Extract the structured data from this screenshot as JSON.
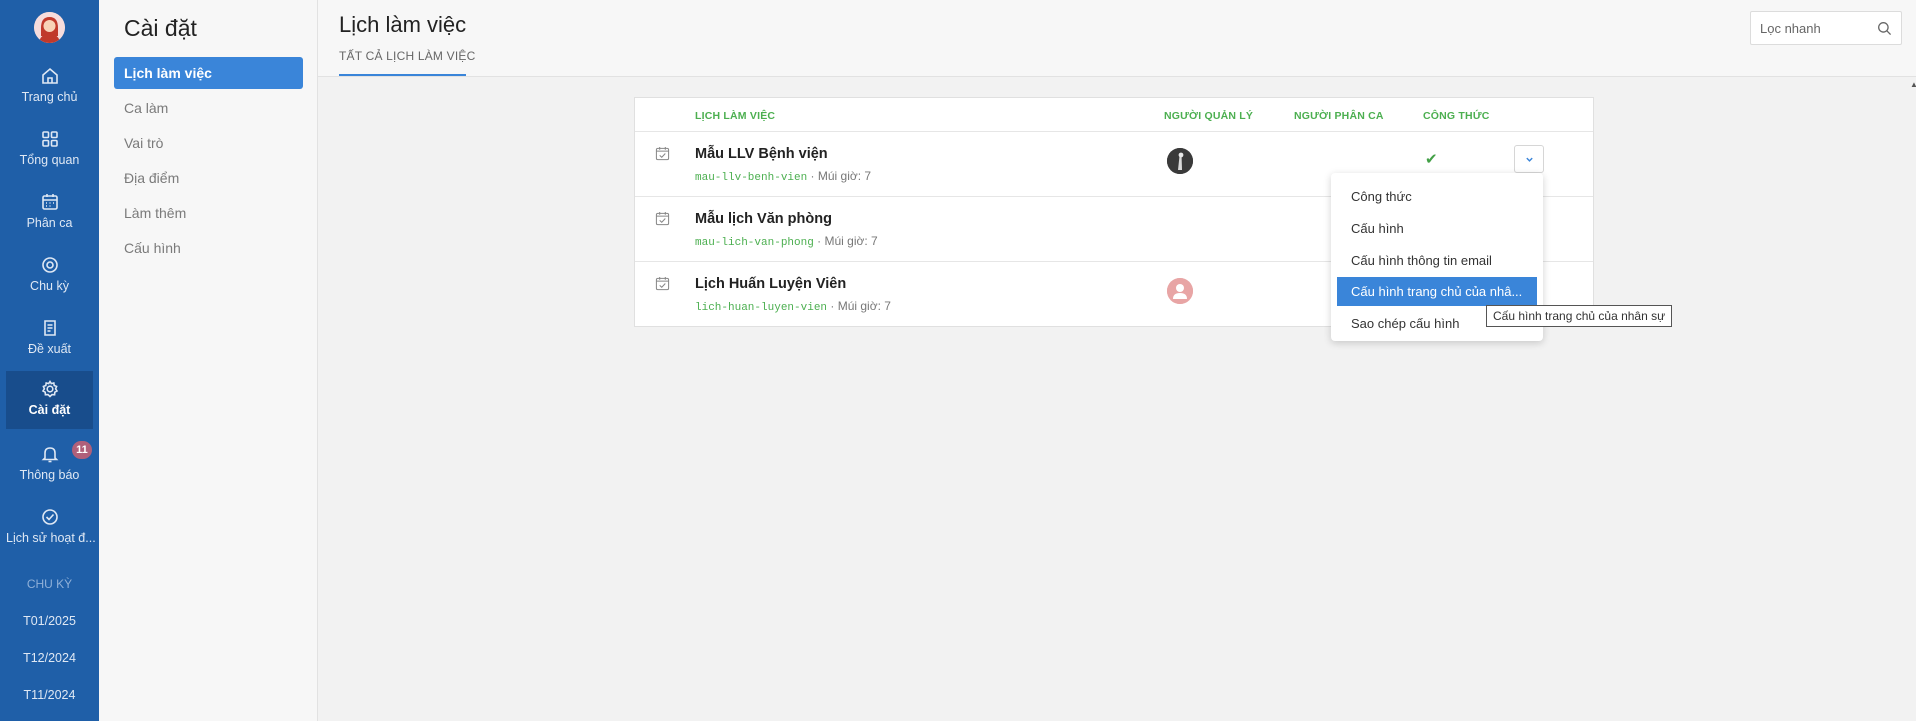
{
  "rail": {
    "items": [
      {
        "label": "Trang chủ",
        "icon": "home-icon"
      },
      {
        "label": "Tổng quan",
        "icon": "grid-icon"
      },
      {
        "label": "Phân ca",
        "icon": "calendar-icon"
      },
      {
        "label": "Chu kỳ",
        "icon": "circle-icon"
      },
      {
        "label": "Đề xuất",
        "icon": "document-icon"
      },
      {
        "label": "Cài đặt",
        "icon": "gear-icon"
      },
      {
        "label": "Thông báo",
        "icon": "bell-icon"
      },
      {
        "label": "Lịch sử hoạt đ...",
        "icon": "check-circle-icon"
      }
    ],
    "notification_count": "11",
    "cycle_heading": "CHU KỲ",
    "cycles": [
      "T01/2025",
      "T12/2024",
      "T11/2024"
    ],
    "active_color": "#184d8c",
    "background": "#1f5fa8"
  },
  "settings": {
    "title": "Cài đặt",
    "items": [
      "Lịch làm việc",
      "Ca làm",
      "Vai trò",
      "Địa điểm",
      "Làm thêm",
      "Cấu hình"
    ]
  },
  "header": {
    "title": "Lịch làm việc",
    "tab": "TẤT CẢ LỊCH LÀM VIỆC",
    "search_placeholder": "Lọc nhanh"
  },
  "table": {
    "columns": {
      "schedule": "LỊCH LÀM VIỆC",
      "manager": "NGƯỜI QUẢN LÝ",
      "assigner": "NGƯỜI PHÂN CA",
      "formula": "CÔNG THỨC"
    },
    "rows": [
      {
        "name": "Mẫu LLV Bệnh viện",
        "code": "mau-llv-benh-vien",
        "timezone": " · Múi giờ: 7",
        "has_formula": true
      },
      {
        "name": "Mẫu lịch Văn phòng",
        "code": "mau-lich-van-phong",
        "timezone": " · Múi giờ: 7",
        "has_formula": false
      },
      {
        "name": "Lịch Huấn Luyện Viên",
        "code": "lich-huan-luyen-vien",
        "timezone": " · Múi giờ: 7",
        "has_formula": false
      }
    ],
    "accent_color": "#4caf50"
  },
  "menu": {
    "items": [
      "Công thức",
      "Cấu hình",
      "Cấu hình thông tin email",
      "Cấu hình trang chủ của nhâ...",
      "Sao chép cấu hình"
    ],
    "highlighted_index": 3,
    "tooltip": "Cấu hình trang chủ của nhân sự"
  }
}
